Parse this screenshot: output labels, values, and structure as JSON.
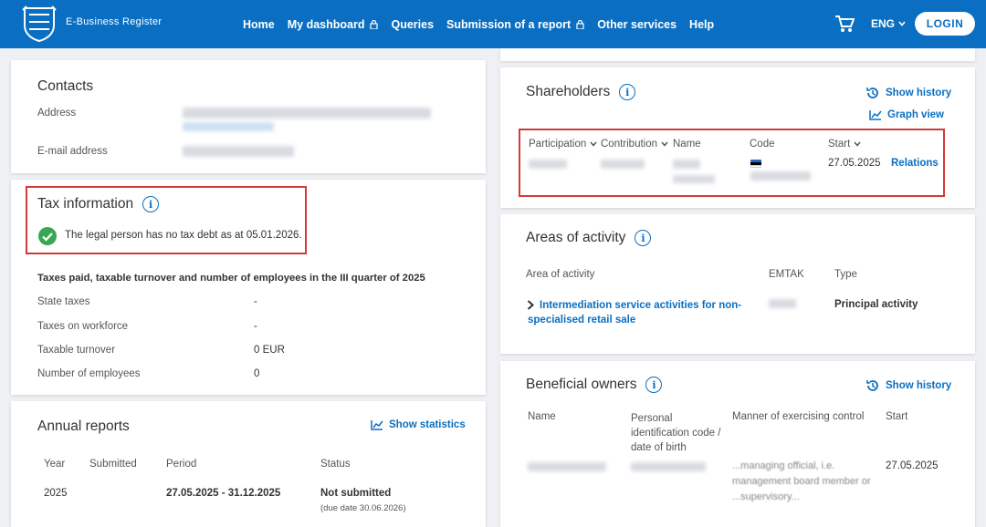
{
  "header": {
    "brand": "E-Business Register",
    "nav": [
      {
        "label": "Home",
        "locked": false
      },
      {
        "label": "My dashboard",
        "locked": true
      },
      {
        "label": "Queries",
        "locked": false
      },
      {
        "label": "Submission of a report",
        "locked": true
      },
      {
        "label": "Other services",
        "locked": false
      },
      {
        "label": "Help",
        "locked": false
      }
    ],
    "language": "ENG",
    "login_label": "LOGIN",
    "bar_color": "#0a6fc2"
  },
  "contacts": {
    "title": "Contacts",
    "address_label": "Address",
    "email_label": "E-mail address"
  },
  "tax": {
    "title": "Tax information",
    "status_text": "The legal person has no tax debt as at 05.01.2026.",
    "quarter_heading": "Taxes paid, taxable turnover and number of employees in the III quarter of 2025",
    "rows": [
      {
        "label": "State taxes",
        "value": "-"
      },
      {
        "label": "Taxes on workforce",
        "value": "-"
      },
      {
        "label": "Taxable turnover",
        "value": "0 EUR"
      },
      {
        "label": "Number of employees",
        "value": "0"
      }
    ]
  },
  "annual": {
    "title": "Annual reports",
    "show_statistics": "Show statistics",
    "columns": [
      "Year",
      "Submitted",
      "Period",
      "Status"
    ],
    "row": {
      "year": "2025",
      "period": "27.05.2025 - 31.12.2025",
      "status": "Not submitted",
      "due": "(due date 30.06.2026)"
    }
  },
  "shareholders": {
    "title": "Shareholders",
    "show_history": "Show history",
    "graph_view": "Graph view",
    "columns": [
      "Participation",
      "Contribution",
      "Name",
      "Code",
      "Start"
    ],
    "row": {
      "start": "27.05.2025",
      "relations": "Relations"
    }
  },
  "activity": {
    "title": "Areas of activity",
    "columns": [
      "Area of activity",
      "EMTAK",
      "Type"
    ],
    "row": {
      "area": "Intermediation service activities for non-specialised retail sale",
      "type": "Principal activity"
    }
  },
  "owners": {
    "title": "Beneficial owners",
    "show_history": "Show history",
    "columns": [
      "Name",
      "Personal identification code / date of birth",
      "Manner of exercising control",
      "Start"
    ],
    "row": {
      "manner": "...managing official, i.e. management board member or ...supervisory...",
      "start": "27.05.2025"
    }
  },
  "colors": {
    "accent": "#0a6fc2",
    "highlight_box": "#d23a3a",
    "success": "#3aa655"
  }
}
